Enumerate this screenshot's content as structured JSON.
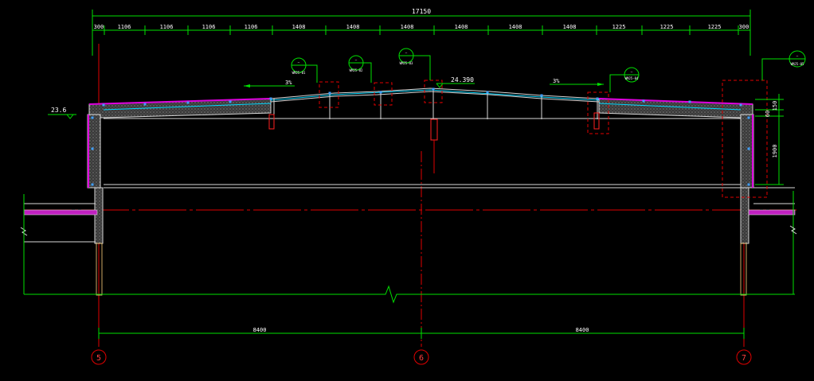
{
  "top_dimensions": {
    "overall": "17150",
    "segments": [
      "300",
      "1106",
      "1106",
      "1106",
      "1106",
      "1408",
      "1408",
      "1408",
      "1408",
      "1408",
      "1408",
      "1225",
      "1225",
      "1225",
      "300"
    ]
  },
  "bottom_dimensions": {
    "left_span": "8400",
    "right_span": "8400"
  },
  "axes": {
    "left": "5",
    "middle": "6",
    "right": "7"
  },
  "elevations": {
    "left": "23.6",
    "ridge": "24.390"
  },
  "slopes": {
    "left": "3%",
    "right": "3%"
  },
  "right_vertical_dimensions": {
    "top": "150",
    "middle": "60",
    "lower": "1900"
  },
  "callouts": [
    {
      "symbol": "—",
      "ref": "WMJ5-01"
    },
    {
      "symbol": "—",
      "ref": "WMJ5-02"
    },
    {
      "symbol": "—",
      "ref": "WMJ5-03"
    },
    {
      "symbol": "—",
      "ref": "WMJ5-04"
    },
    {
      "symbol": "—",
      "ref": "WMJ5-05"
    }
  ],
  "colors": {
    "background": "#000000",
    "dimension": "#00e000",
    "axis": "#e00000",
    "roof_membrane": "#e000e0",
    "structure": "#d8d8d8"
  }
}
